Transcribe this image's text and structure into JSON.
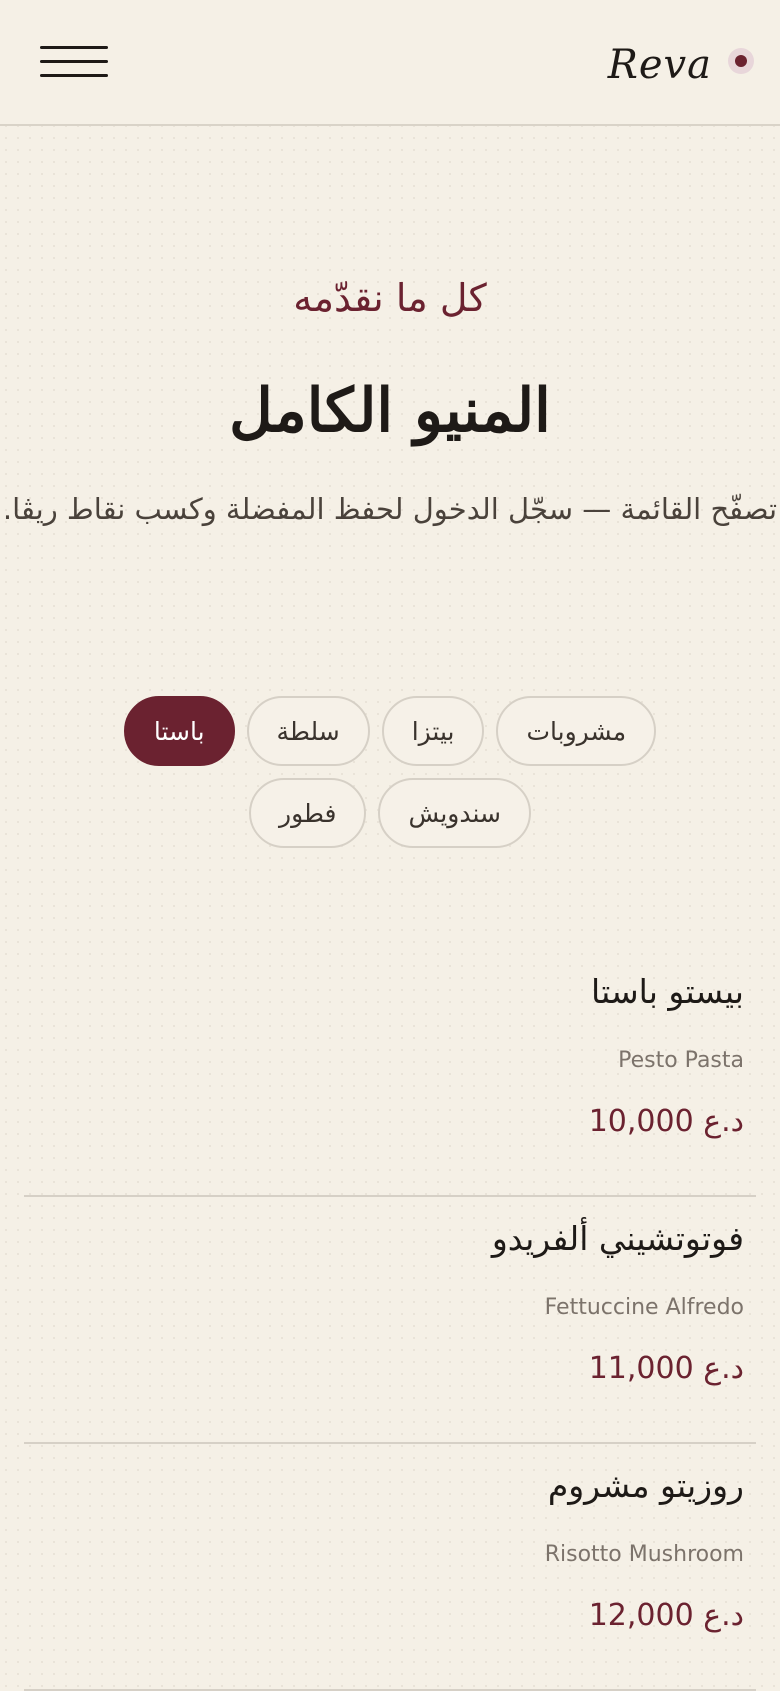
{
  "header": {
    "brand": "Reva",
    "menu_icon": "hamburger-menu-icon",
    "logo_mark": "dot-logo-icon"
  },
  "hero": {
    "eyebrow": "كل ما نقدّمه",
    "title": "المنيو الكامل",
    "subtitle": "تصفّح القائمة — سجّل الدخول لحفظ المفضلة وكسب نقاط ريڤا."
  },
  "categories": [
    {
      "label": "مشروبات",
      "active": false
    },
    {
      "label": "بيتزا",
      "active": false
    },
    {
      "label": "سلطة",
      "active": false
    },
    {
      "label": "باستا",
      "active": true
    },
    {
      "label": "سندويش",
      "active": false
    },
    {
      "label": "فطور",
      "active": false
    }
  ],
  "menu_items": [
    {
      "name_ar": "بيستو باستا",
      "name_en": "Pesto Pasta",
      "price": "10,000 د.ع"
    },
    {
      "name_ar": "فوتوتشيني ألفريدو",
      "name_en": "Fettuccine Alfredo",
      "price": "11,000 د.ع"
    },
    {
      "name_ar": "روزيتو مشروم",
      "name_en": "Risotto Mushroom",
      "price": "12,000 د.ع"
    }
  ],
  "colors": {
    "accent": "#6b2230",
    "background": "#f5f0e6",
    "text": "#1e1a17",
    "muted": "#7c736b",
    "border": "#d6d0c6"
  }
}
